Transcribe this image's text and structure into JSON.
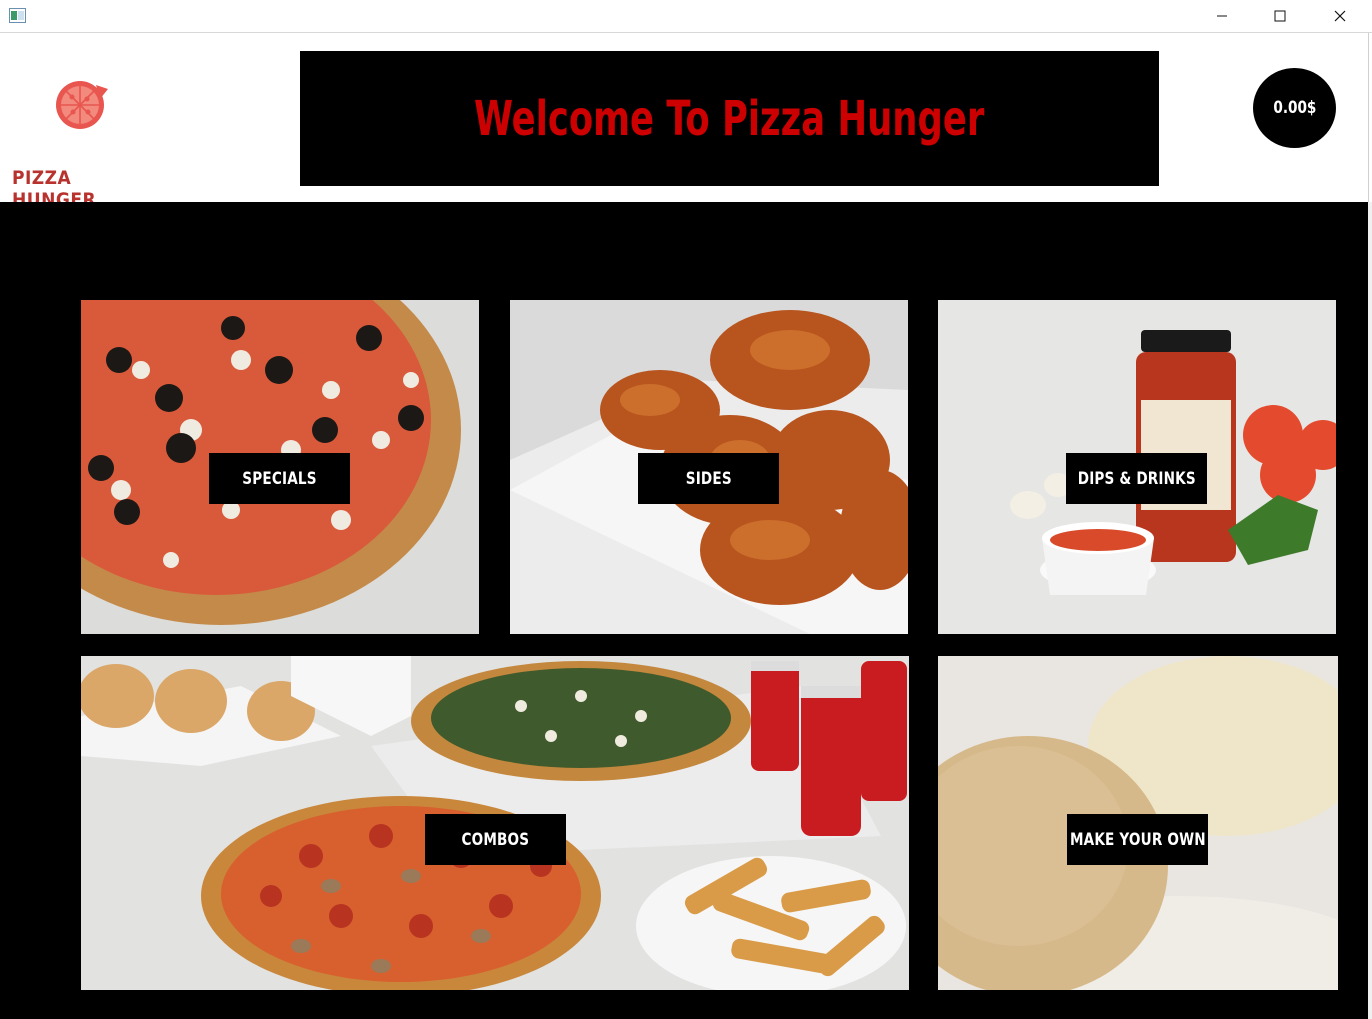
{
  "window": {
    "title": "",
    "controls": {
      "minimize": "minimize-icon",
      "maximize": "maximize-icon",
      "close": "close-icon"
    }
  },
  "header": {
    "logo_text": "PIZZA HUNGER",
    "banner_title": "Welcome To Pizza Hunger",
    "cart_total": "0.00$"
  },
  "colors": {
    "brand_red": "#cc0000",
    "logo_red": "#e8564f",
    "background": "#000000"
  },
  "categories": [
    {
      "label": "SPECIALS",
      "image": "pizza-image"
    },
    {
      "label": "SIDES",
      "image": "chicken-wings-image"
    },
    {
      "label": "DIPS & DRINKS",
      "image": "sauce-jar-image"
    },
    {
      "label": "COMBOS",
      "image": "combo-meal-image"
    },
    {
      "label": "MAKE YOUR OWN",
      "image": "dough-image"
    }
  ]
}
